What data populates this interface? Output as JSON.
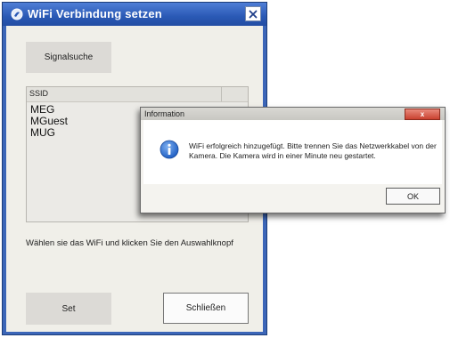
{
  "main_window": {
    "title": "WiFi Verbindung setzen",
    "signal_button": "Signalsuche",
    "ssid_header": "SSID",
    "ssid_items": [
      "MEG",
      "MGuest",
      "MUG"
    ],
    "instruction": "Wählen sie das WiFi und klicken Sie den Auswahlknopf",
    "set_button": "Set",
    "close_button": "Schließen"
  },
  "info_dialog": {
    "title": "Information",
    "close_label": "x",
    "message": "WiFi erfolgreich hinzugefügt. Bitte trennen Sie das Netzwerkkabel von der Kamera. Die Kamera wird in einer Minute neu gestartet.",
    "ok_button": "OK"
  },
  "colors": {
    "titlebar": "#2a59b5",
    "window_bg": "#f0efe9",
    "dialog_close": "#c9412f",
    "info_icon": "#1f5fc4"
  },
  "icons": {
    "app": "app-logo-icon",
    "close": "close-icon",
    "info": "info-icon"
  }
}
